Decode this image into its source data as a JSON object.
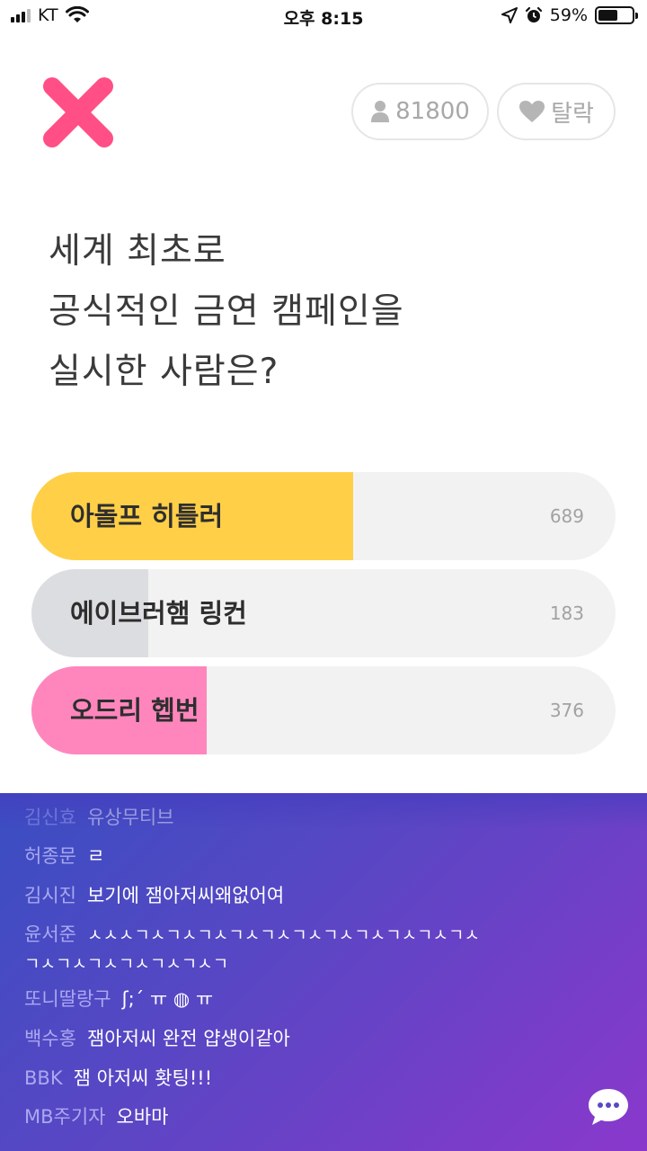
{
  "status_bar": {
    "carrier": "KT",
    "time": "오후 8:15",
    "battery_pct": "59%",
    "battery_level": 0.59,
    "icons": [
      "signal-icon",
      "wifi-icon",
      "location-arrow-icon",
      "alarm-icon",
      "battery-icon"
    ]
  },
  "header": {
    "close_icon": "close-x-icon",
    "accent": "#ff4f86",
    "viewers_count": "81800",
    "viewers_icon": "person-icon",
    "quit_label": "탈락",
    "quit_icon": "heart-icon"
  },
  "question": {
    "lines": [
      "세계 최초로",
      "공식적인 금연 캠페인을",
      "실시한 사람은?"
    ]
  },
  "options": [
    {
      "label": "아돌프 히틀러",
      "count": "689",
      "fill_color": "#ffcf48",
      "fill_fraction": 0.55
    },
    {
      "label": "에이브러햄 링컨",
      "count": "183",
      "fill_color": "#dcdde0",
      "fill_fraction": 0.2
    },
    {
      "label": "오드리 헵번",
      "count": "376",
      "fill_color": "#ff86bd",
      "fill_fraction": 0.3
    }
  ],
  "chat": {
    "messages": [
      {
        "user": "김신효",
        "text": "유상무티브"
      },
      {
        "user": "허종문",
        "text": "ㄹ"
      },
      {
        "user": "김시진",
        "text": "보기에 잼아저씨왜없어여"
      },
      {
        "user": "윤서준",
        "text": "ㅅㅅㅅㄱㅅㄱㅅㄱㅅㄱㅅㄱㅅㄱㅅㄱㅅㄱㅅㄱㅅㄱㅅㄱㅅ",
        "continuation": "ㄱㅅㄱㅅㄱㅅㄱㅅㄱㅅㄱㅅㄱ"
      },
      {
        "user": "또니딸랑구",
        "text": "ʃ;ˊ  ㅠ  ◍  ㅠ"
      },
      {
        "user": "백수홍",
        "text": "잼아저씨 완전 얍생이같아"
      },
      {
        "user": "BBK",
        "text": "잼 아저씨 홧팅!!!"
      },
      {
        "user": "MB주기자",
        "text": "오바마"
      }
    ],
    "chat_button_icon": "chat-bubble-icon"
  }
}
